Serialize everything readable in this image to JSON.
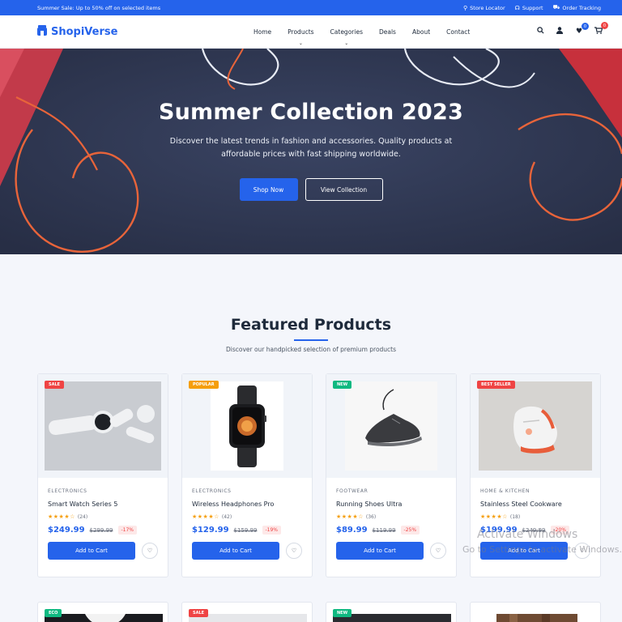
{
  "topbar": {
    "promo": "Summer Sale: Up to 50% off on selected items",
    "links": [
      {
        "icon": "location-pin-icon",
        "label": "Store Locator"
      },
      {
        "icon": "headset-icon",
        "label": "Support"
      },
      {
        "icon": "truck-icon",
        "label": "Order Tracking"
      }
    ]
  },
  "header": {
    "logo": "ShopiVerse",
    "nav": [
      "Home",
      "Products",
      "Categories",
      "Deals",
      "About",
      "Contact"
    ],
    "wishlist_count": "0",
    "cart_count": "0"
  },
  "hero": {
    "title": "Summer Collection 2023",
    "subtitle": "Discover the latest trends in fashion and accessories. Quality products at affordable prices with fast shipping worldwide.",
    "primary_button": "Shop Now",
    "secondary_button": "View Collection"
  },
  "featured": {
    "title": "Featured Products",
    "subtitle": "Discover our handpicked selection of premium products",
    "add_to_cart_label": "Add to Cart",
    "products": [
      {
        "tag": "SALE",
        "category": "ELECTRONICS",
        "name": "Smart Watch Series 5",
        "stars": "★★★★☆",
        "reviews": "(24)",
        "price": "$249.99",
        "old_price": "$299.99",
        "discount": "-17%"
      },
      {
        "tag": "POPULAR",
        "category": "ELECTRONICS",
        "name": "Wireless Headphones Pro",
        "stars": "★★★★☆",
        "reviews": "(42)",
        "price": "$129.99",
        "old_price": "$159.99",
        "discount": "-19%"
      },
      {
        "tag": "NEW",
        "category": "FOOTWEAR",
        "name": "Running Shoes Ultra",
        "stars": "★★★★☆",
        "reviews": "(36)",
        "price": "$89.99",
        "old_price": "$119.99",
        "discount": "-25%"
      },
      {
        "tag": "BEST SELLER",
        "category": "HOME & KITCHEN",
        "name": "Stainless Steel Cookware",
        "stars": "★★★★☆",
        "reviews": "(18)",
        "price": "$199.99",
        "old_price": "$249.99",
        "discount": "-20%"
      }
    ],
    "row2_tags": [
      "ECO",
      "SALE",
      "NEW"
    ]
  },
  "watermark": {
    "line1": "Activate Windows",
    "line2": "Go to Settings to activate Windows."
  },
  "colors": {
    "accent": "#2563eb",
    "sale": "#ef4444",
    "popular": "#f59e0b",
    "new": "#10b981"
  }
}
